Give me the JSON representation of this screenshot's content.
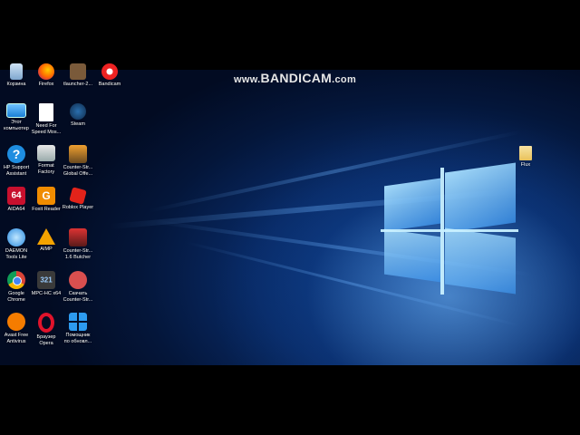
{
  "watermark": {
    "www": "www.",
    "brand": "BANDICAM",
    "tld": ".com"
  },
  "desktop_icons": [
    {
      "label": "Корзина",
      "icon": "recycle-bin-icon"
    },
    {
      "label": "Firefox",
      "icon": "firefox-icon"
    },
    {
      "label": "tlauncher-2...",
      "icon": "tlauncher-icon"
    },
    {
      "label": "Bandicam",
      "icon": "bandicam-icon"
    },
    {
      "label": "Этот\nкомпьютер",
      "icon": "this-pc-icon"
    },
    {
      "label": "Need For\nSpeed Mos...",
      "icon": "nfs-icon"
    },
    {
      "label": "Steam",
      "icon": "steam-icon"
    },
    {
      "label": "HP Support\nAssistant",
      "icon": "hp-support-icon"
    },
    {
      "label": "Format\nFactory",
      "icon": "format-factory-icon"
    },
    {
      "label": "Counter-Str...\nGlobal Offe...",
      "icon": "csgo-icon"
    },
    {
      "label": "AIDA64",
      "icon": "aida64-icon",
      "text": "64"
    },
    {
      "label": "Foxit Reader",
      "icon": "foxit-reader-icon"
    },
    {
      "label": "Roblox Player",
      "icon": "roblox-icon"
    },
    {
      "label": "DAEMON\nTools Lite",
      "icon": "daemon-tools-icon"
    },
    {
      "label": "AIMP",
      "icon": "aimp-icon"
    },
    {
      "label": "Counter-Str...\n1.6 Butcher",
      "icon": "cs16-icon"
    },
    {
      "label": "Google\nChrome",
      "icon": "chrome-icon"
    },
    {
      "label": "MPC-HC x64",
      "icon": "mpc-hc-icon",
      "text": "321"
    },
    {
      "label": "Скачать\nCounter-Str...",
      "icon": "download-cs-icon"
    },
    {
      "label": "Avast Free\nAntivirus",
      "icon": "avast-icon"
    },
    {
      "label": "Браузер\nOpera",
      "icon": "opera-icon"
    },
    {
      "label": "Помощник\nпо обновл...",
      "icon": "windows-update-assistant-icon"
    },
    {
      "label": "Flux",
      "icon": "folder-icon"
    }
  ]
}
